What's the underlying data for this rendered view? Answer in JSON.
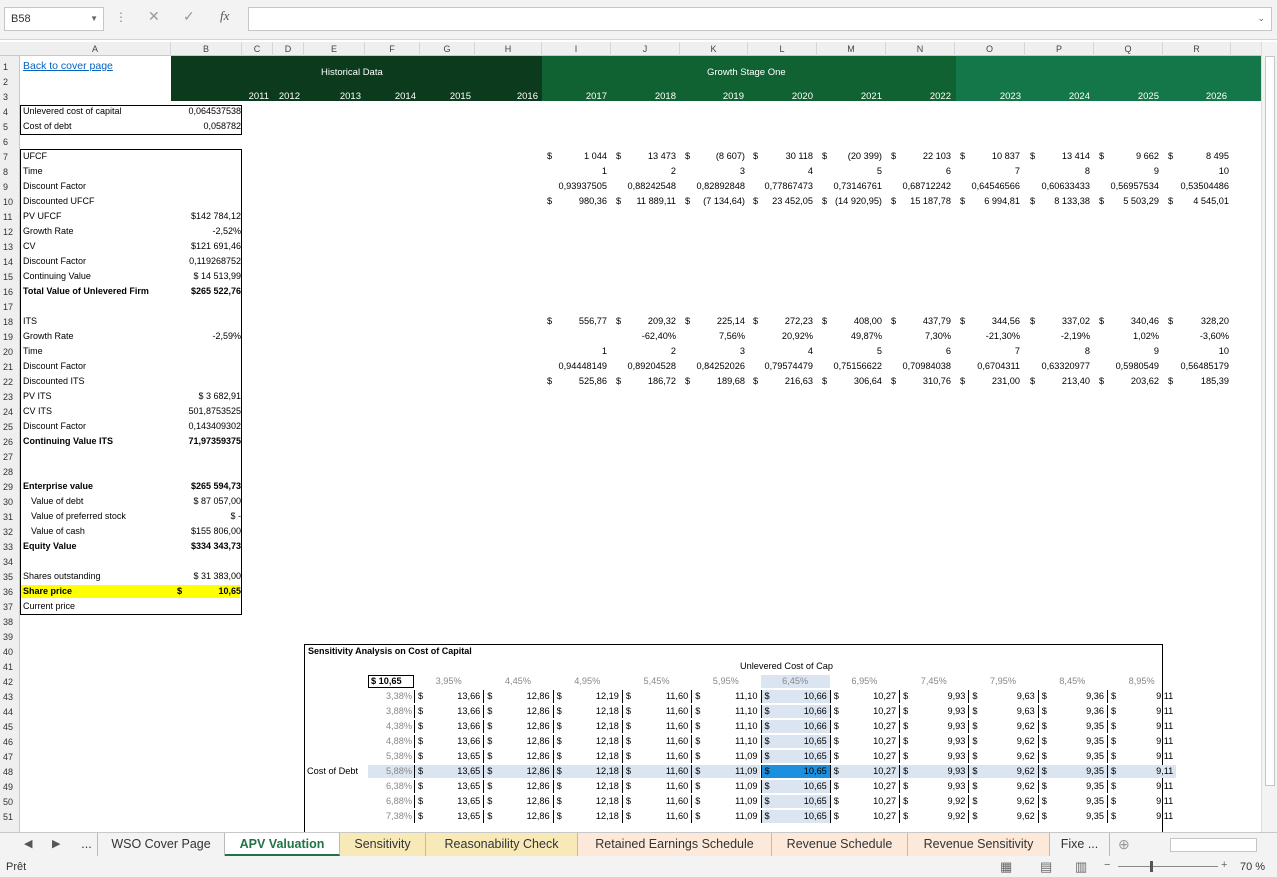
{
  "formula_bar": {
    "name_box": "B58",
    "cancel_icon": "✕",
    "enter_icon": "✓",
    "fx_label": "fx",
    "content": ""
  },
  "columns": [
    "A",
    "B",
    "C",
    "D",
    "E",
    "F",
    "G",
    "H",
    "I",
    "J",
    "K",
    "L",
    "M",
    "N",
    "O",
    "P",
    "Q",
    "R"
  ],
  "rows": [
    "1",
    "2",
    "3",
    "4",
    "5",
    "6",
    "7",
    "8",
    "9",
    "10",
    "11",
    "12",
    "13",
    "14",
    "15",
    "16",
    "17",
    "18",
    "19",
    "20",
    "21",
    "22",
    "23",
    "24",
    "25",
    "26",
    "27",
    "28",
    "29",
    "30",
    "31",
    "32",
    "33",
    "34",
    "35",
    "36",
    "37",
    "38",
    "39",
    "40",
    "41",
    "42",
    "43",
    "44",
    "45",
    "46",
    "47",
    "48",
    "49",
    "50",
    "51"
  ],
  "header": {
    "back_link": "Back to cover page",
    "historical": "Historical Data",
    "growth": "Growth Stage One",
    "years": [
      "2011",
      "2012",
      "2013",
      "2014",
      "2015",
      "2016",
      "2017",
      "2018",
      "2019",
      "2020",
      "2021",
      "2022",
      "2023",
      "2024",
      "2025",
      "2026"
    ]
  },
  "colors": {
    "dark_green": "#0b3a1c",
    "mid_green": "#116233",
    "bright_green": "#13774a",
    "yellow": "#ffff00",
    "selected": "#1d8fdf",
    "tab_active": "#217346"
  },
  "labels": {
    "r4": "Unlevered cost of capital",
    "r5": "Cost of debt",
    "r7": "UFCF",
    "r8": "Time",
    "r9": "Discount Factor",
    "r10": "Discounted UFCF",
    "r11": "PV UFCF",
    "r12": "Growth Rate",
    "r13": "CV",
    "r14": "Discount Factor",
    "r15": "Continuing Value",
    "r16": "Total Value of Unlevered Firm",
    "r18": "ITS",
    "r19": "Growth Rate",
    "r20": "Time",
    "r21": "Discount Factor",
    "r22": "Discounted ITS",
    "r23": "PV ITS",
    "r24": "CV ITS",
    "r25": "Discount Factor",
    "r26": "Continuing Value ITS",
    "r29": "Enterprise value",
    "r30": "Value of debt",
    "r31": "Value of preferred stock",
    "r32": "Value of cash",
    "r33": "Equity Value",
    "r35": "Shares outstanding",
    "r36": "Share price",
    "r37": "Current price"
  },
  "values": {
    "r4": "0,064537538",
    "r5": "0,058782",
    "r11": "$142 784,12",
    "r12": "-2,52%",
    "r13": "$121 691,46",
    "r14": "0,119268752",
    "r15": "$  14 513,99",
    "r16": "$265 522,76",
    "r19": "-2,59%",
    "r23": "$    3 682,91",
    "r24": "501,8753525",
    "r25": "0,143409302",
    "r26": "71,97359375",
    "r29": "$265 594,73",
    "r30": "$  87 057,00",
    "r31": "$            -",
    "r32": "$155 806,00",
    "r33": "$334 343,73",
    "r35": "$  31 383,00",
    "r36_sym": "$",
    "r36": "10,65"
  },
  "ufcf": [
    "1 044",
    "13 473",
    "(8 607)",
    "30 118",
    "(20 399)",
    "22 103",
    "10 837",
    "13 414",
    "9 662",
    "8 495"
  ],
  "time": [
    "1",
    "2",
    "3",
    "4",
    "5",
    "6",
    "7",
    "8",
    "9",
    "10"
  ],
  "df": [
    "0,93937505",
    "0,88242548",
    "0,82892848",
    "0,77867473",
    "0,73146761",
    "0,68712242",
    "0,64546566",
    "0,60633433",
    "0,56957534",
    "0,53504486"
  ],
  "dufcf": [
    "980,36",
    "11 889,11",
    "(7 134,64)",
    "23 452,05",
    "(14 920,95)",
    "15 187,78",
    "6 994,81",
    "8 133,38",
    "5 503,29",
    "4 545,01"
  ],
  "its": [
    "556,77",
    "209,32",
    "225,14",
    "272,23",
    "408,00",
    "437,79",
    "344,56",
    "337,02",
    "340,46",
    "328,20"
  ],
  "its_g": [
    "",
    "-62,40%",
    "7,56%",
    "20,92%",
    "49,87%",
    "7,30%",
    "-21,30%",
    "-2,19%",
    "1,02%",
    "-3,60%"
  ],
  "its_df": [
    "0,94448149",
    "0,89204528",
    "0,84252026",
    "0,79574479",
    "0,75156622",
    "0,70984038",
    "0,6704311",
    "0,63320977",
    "0,5980549",
    "0,56485179"
  ],
  "dits": [
    "525,86",
    "186,72",
    "189,68",
    "216,63",
    "306,64",
    "310,76",
    "231,00",
    "213,40",
    "203,62",
    "185,39"
  ],
  "sens": {
    "title": "Sensitivity Analysis on Cost of Capital",
    "top": "Unlevered Cost of Cap",
    "side": "Cost of Debt",
    "corner": "$   10,65",
    "cols": [
      "3,95%",
      "4,45%",
      "4,95%",
      "5,45%",
      "5,95%",
      "6,45%",
      "6,95%",
      "7,45%",
      "7,95%",
      "8,45%",
      "8,95%"
    ],
    "rows": [
      {
        "k": "3,38%",
        "v": [
          "13,66",
          "12,86",
          "12,19",
          "11,60",
          "11,10",
          "10,66",
          "10,27",
          "9,93",
          "9,63",
          "9,36",
          "9,11"
        ]
      },
      {
        "k": "3,88%",
        "v": [
          "13,66",
          "12,86",
          "12,18",
          "11,60",
          "11,10",
          "10,66",
          "10,27",
          "9,93",
          "9,63",
          "9,36",
          "9,11"
        ]
      },
      {
        "k": "4,38%",
        "v": [
          "13,66",
          "12,86",
          "12,18",
          "11,60",
          "11,10",
          "10,66",
          "10,27",
          "9,93",
          "9,62",
          "9,35",
          "9,11"
        ]
      },
      {
        "k": "4,88%",
        "v": [
          "13,66",
          "12,86",
          "12,18",
          "11,60",
          "11,10",
          "10,65",
          "10,27",
          "9,93",
          "9,62",
          "9,35",
          "9,11"
        ]
      },
      {
        "k": "5,38%",
        "v": [
          "13,65",
          "12,86",
          "12,18",
          "11,60",
          "11,09",
          "10,65",
          "10,27",
          "9,93",
          "9,62",
          "9,35",
          "9,11"
        ]
      },
      {
        "k": "5,88%",
        "v": [
          "13,65",
          "12,86",
          "12,18",
          "11,60",
          "11,09",
          "10,65",
          "10,27",
          "9,93",
          "9,62",
          "9,35",
          "9,11"
        ]
      },
      {
        "k": "6,38%",
        "v": [
          "13,65",
          "12,86",
          "12,18",
          "11,60",
          "11,09",
          "10,65",
          "10,27",
          "9,93",
          "9,62",
          "9,35",
          "9,11"
        ]
      },
      {
        "k": "6,88%",
        "v": [
          "13,65",
          "12,86",
          "12,18",
          "11,60",
          "11,09",
          "10,65",
          "10,27",
          "9,92",
          "9,62",
          "9,35",
          "9,11"
        ]
      },
      {
        "k": "7,38%",
        "v": [
          "13,65",
          "12,86",
          "12,18",
          "11,60",
          "11,09",
          "10,65",
          "10,27",
          "9,92",
          "9,62",
          "9,35",
          "9,11"
        ]
      }
    ]
  },
  "tabs": [
    "...",
    "WSO Cover Page",
    "APV Valuation",
    "Sensitivity",
    "Reasonability Check",
    "Retained Earnings Schedule",
    "Revenue Schedule",
    "Revenue Sensitivity",
    "Fixe ..."
  ],
  "status": {
    "ready": "Prêt",
    "zoom": "70 %"
  }
}
